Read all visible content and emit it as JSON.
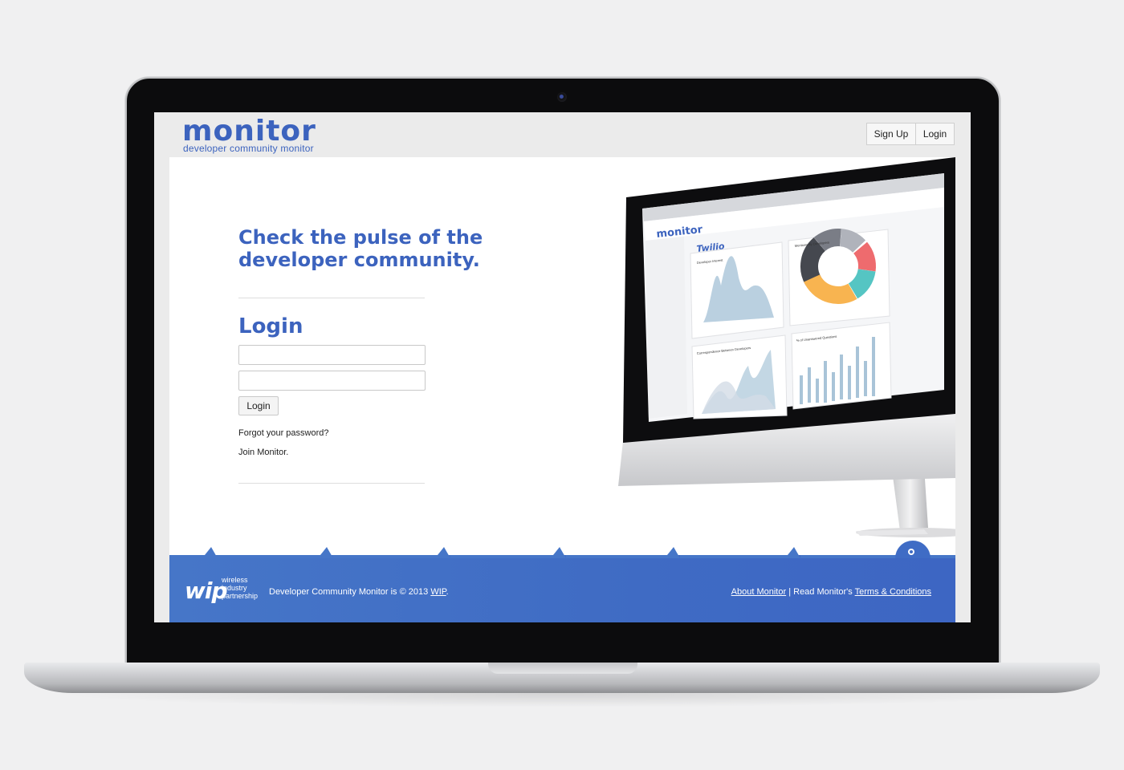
{
  "header": {
    "logo_text": "monitor",
    "logo_tagline": "developer community monitor",
    "signup_label": "Sign Up",
    "login_label": "Login"
  },
  "hero": {
    "headline_line1": "Check the pulse of the",
    "headline_line2": "developer community."
  },
  "login_form": {
    "heading": "Login",
    "username_value": "",
    "password_value": "",
    "submit_label": "Login",
    "forgot_link": "Forgot your password?",
    "join_link": "Join Monitor."
  },
  "imac_preview": {
    "app_logo": "monitor",
    "brand": "Twilio",
    "panel_1_title": "Developer Interest",
    "panel_2_title": "Mentions By Developers",
    "panel_3_title": "Correspondence Between Developers",
    "panel_4_title": "% of Unanswered Questions"
  },
  "footer": {
    "wip_mark": "wip",
    "wip_line1": "wireless",
    "wip_line2": "industry",
    "wip_line3": "partnership",
    "copyright_prefix": "Developer Community Monitor is © 2013 ",
    "copyright_link": "WIP",
    "copyright_suffix": ".",
    "about_link": "About Monitor",
    "separator": " | ",
    "read_prefix": "Read Monitor's ",
    "terms_link": "Terms & Conditions"
  },
  "colors": {
    "brand_blue": "#3c63be",
    "footer_blue": "#4272c6",
    "donut": [
      "#45484f",
      "#7a7d86",
      "#b0b3bb",
      "#f8b450",
      "#55c5c3",
      "#ee6b6e"
    ]
  }
}
